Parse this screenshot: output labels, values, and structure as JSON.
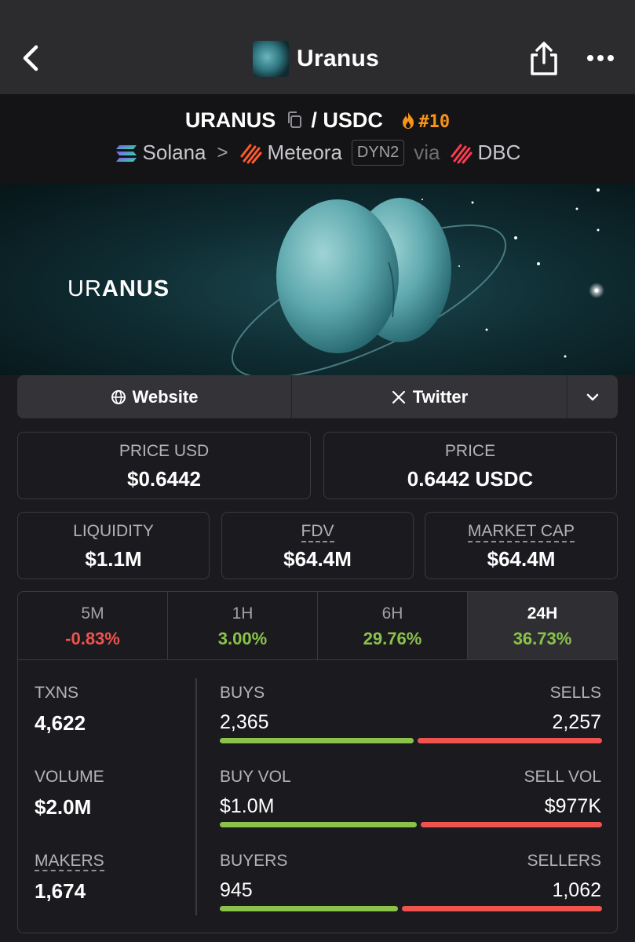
{
  "nav": {
    "title": "Uranus",
    "back_icon": "chevron-left-icon",
    "share_icon": "share-icon",
    "more_icon": "more-horizontal-icon"
  },
  "pair": {
    "base": "URANUS",
    "separator": "/",
    "quote": "USDC",
    "rank": "#10",
    "chain": "Solana",
    "dex": "Meteora",
    "pool_type": "DYN2",
    "via": "via",
    "launchpad": "DBC"
  },
  "banner": {
    "text_light": "UR",
    "text_bold": "ANUS"
  },
  "links": {
    "website": "Website",
    "twitter": "Twitter"
  },
  "price_usd": {
    "label": "PRICE USD",
    "value": "$0.6442"
  },
  "price": {
    "label": "PRICE",
    "value": "0.6442 USDC"
  },
  "liquidity": {
    "label": "LIQUIDITY",
    "value": "$1.1M"
  },
  "fdv": {
    "label": "FDV",
    "value": "$64.4M"
  },
  "market_cap": {
    "label": "MARKET CAP",
    "value": "$64.4M"
  },
  "tabs": [
    {
      "label": "5M",
      "change": "-0.83%"
    },
    {
      "label": "1H",
      "change": "3.00%"
    },
    {
      "label": "6H",
      "change": "29.76%"
    },
    {
      "label": "24H",
      "change": "36.73%"
    }
  ],
  "stats": {
    "txns": {
      "label": "TXNS",
      "value": "4,622"
    },
    "volume": {
      "label": "VOLUME",
      "value": "$2.0M"
    },
    "makers": {
      "label": "MAKERS",
      "value": "1,674"
    },
    "buys": {
      "label": "BUYS",
      "value": "2,365"
    },
    "sells": {
      "label": "SELLS",
      "value": "2,257"
    },
    "buy_vol": {
      "label": "BUY VOL",
      "value": "$1.0M"
    },
    "sell_vol": {
      "label": "SELL VOL",
      "value": "$977K"
    },
    "buyers": {
      "label": "BUYERS",
      "value": "945"
    },
    "sellers": {
      "label": "SELLERS",
      "value": "1,062"
    },
    "buy_ratios": {
      "buys": 0.512,
      "buy_vol": 0.52,
      "buyers": 0.471
    }
  },
  "colors": {
    "positive": "#8bc34a",
    "negative": "#ef5350",
    "rank": "#f7931a"
  }
}
